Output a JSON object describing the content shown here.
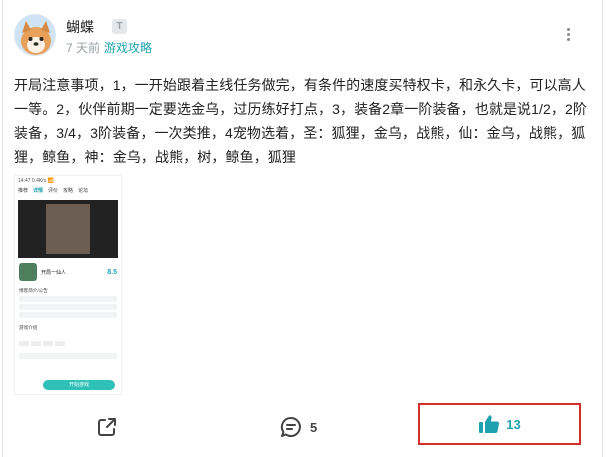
{
  "post": {
    "author": "蝴蝶",
    "level_badge": "T",
    "time": "7 天前",
    "category": "游戏攻略",
    "body": "开局注意事项，1，一开始跟着主线任务做完，有条件的速度买特权卡，和永久卡，可以高人一等。2，伙伴前期一定要选金乌，过历练好打点，3，装备2章一阶装备，也就是说1/2，2阶装备，3/4，3阶装备，一次类推，4宠物选着，圣：狐狸，金乌，战熊，仙：金乌，战熊，狐狸，鲸鱼，神：金乌，战熊，树，鲸鱼，狐狸"
  },
  "actions": {
    "comment_count": "5",
    "like_count": "13"
  },
  "embedded_screenshot": {
    "status": "14:47 0.4K/s 📶",
    "tabs": [
      "推荐",
      "详情",
      "评价",
      "攻略",
      "论坛"
    ],
    "selected_tab": "详情",
    "game_name": "开局一仙人",
    "score": "8.5",
    "section_1": "博客简介/公告",
    "section_2": "游戏介绍",
    "download_label": "开始游戏"
  },
  "colors": {
    "accent": "#1fa2b0",
    "highlight_border": "#d32f2f"
  }
}
